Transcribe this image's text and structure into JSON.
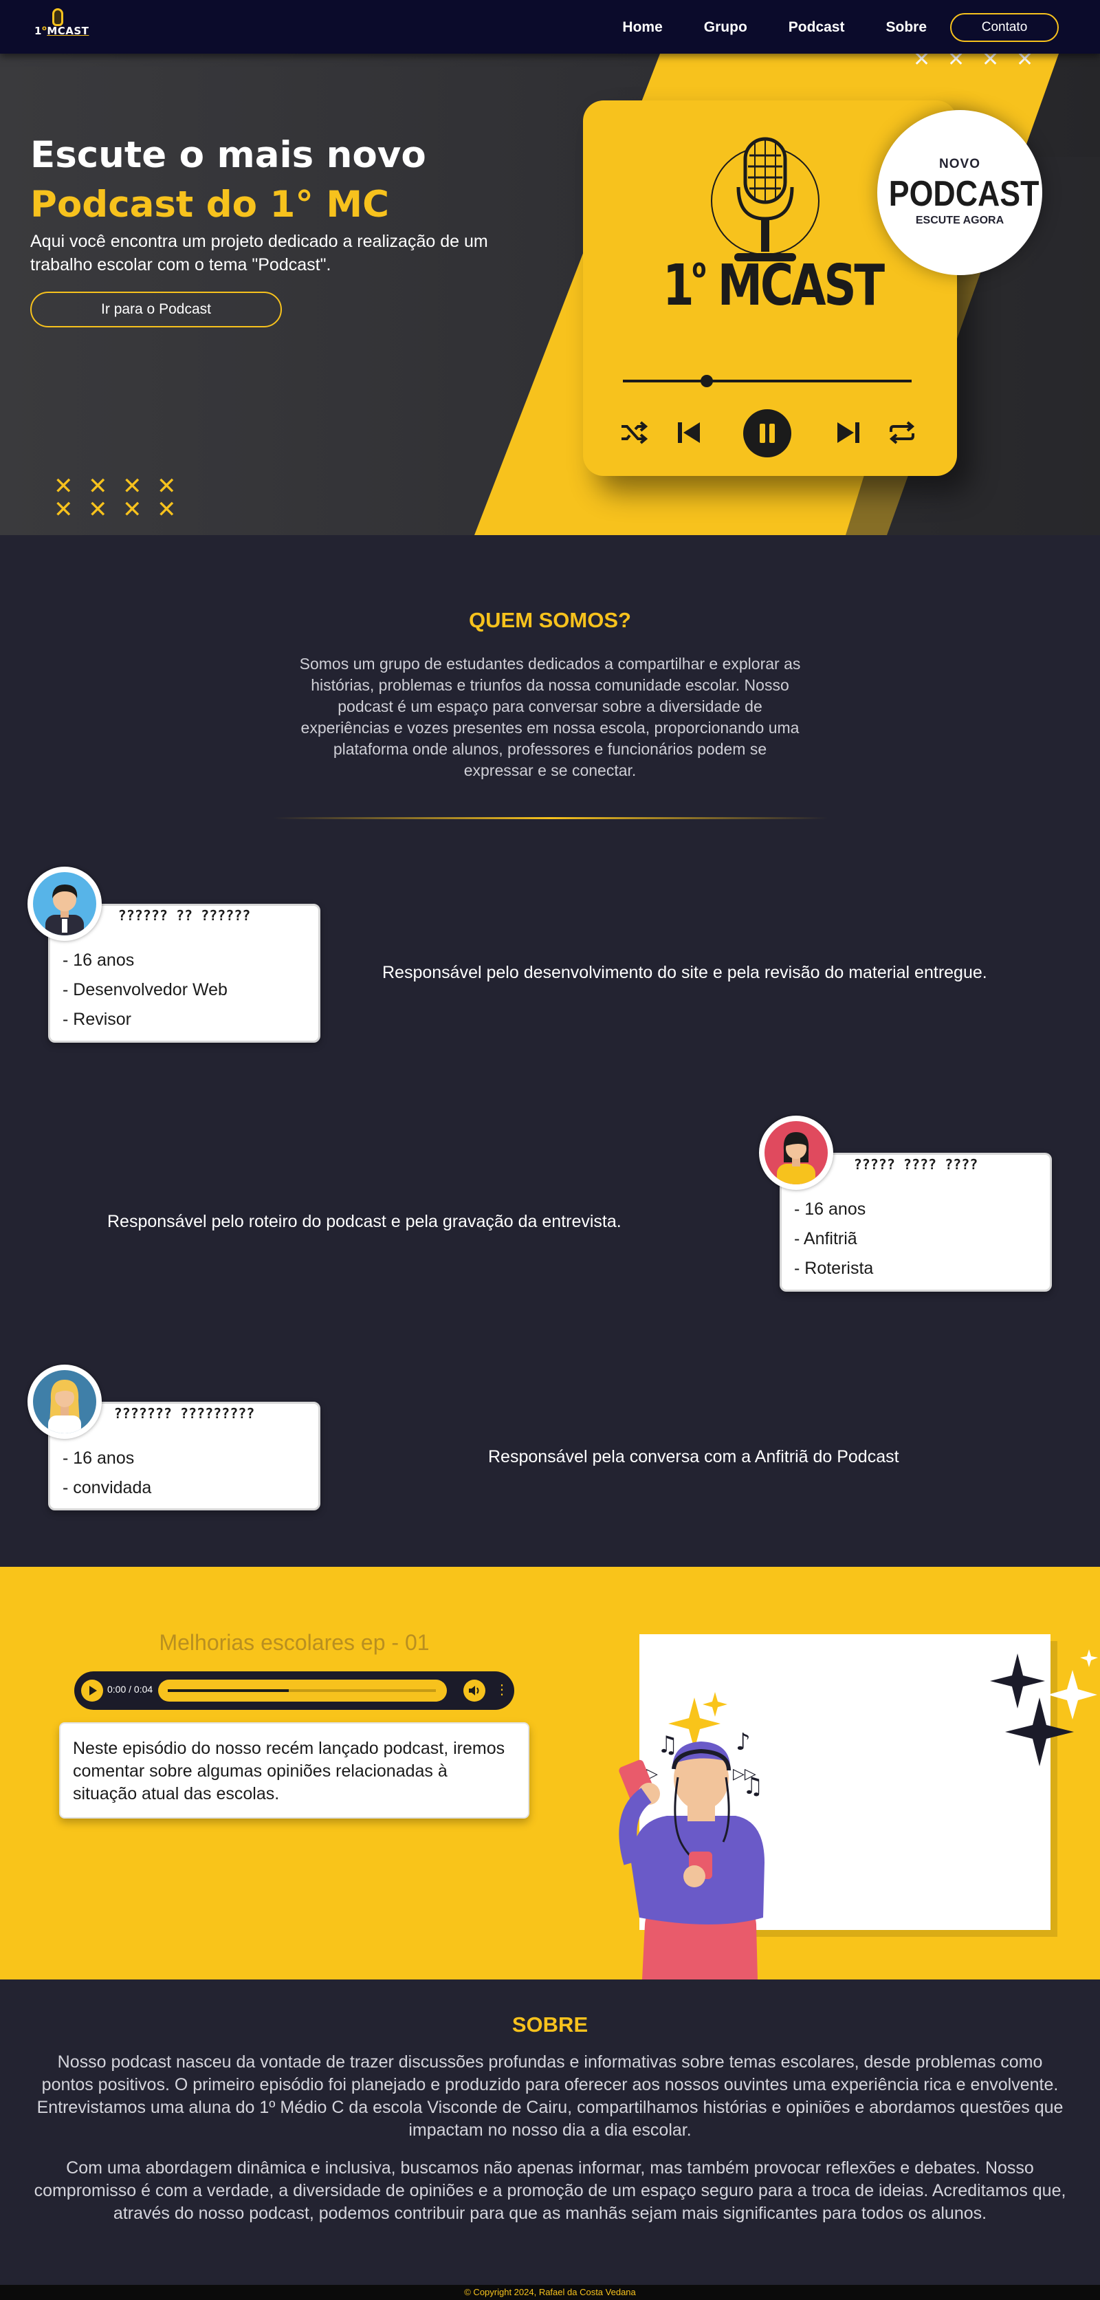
{
  "nav": {
    "logo_text": "1",
    "logo_sup": "o",
    "logo_word": "MCAST",
    "links": [
      "Home",
      "Grupo",
      "Podcast",
      "Sobre"
    ],
    "cta": "Contato"
  },
  "hero": {
    "title_line1": "Escute o mais novo",
    "title_line2": "Podcast do 1° MC",
    "description": "Aqui você encontra um projeto dedicado a realização de um trabalho escolar com o tema \"Podcast\".",
    "button": "Ir para o Podcast",
    "brand": "1",
    "brand_sup": "o",
    "brand_word": "MCAST",
    "badge_top": "NOVO",
    "badge_mid": "PODCAST",
    "badge_bottom": "ESCUTE AGORA",
    "player_progress": 0.29,
    "accent_color": "#f7c21d"
  },
  "about_group": {
    "title": "QUEM SOMOS?",
    "text": "Somos um grupo de estudantes dedicados a compartilhar e explorar as histórias, problemas e triunfos da nossa comunidade escolar. Nosso podcast é um espaço para conversar sobre a diversidade de experiências e vozes presentes em nossa escola, proporcionando uma plataforma onde alunos, professores e funcionários podem se expressar e se conectar."
  },
  "members": [
    {
      "name": "?????? ?? ??????",
      "lines": [
        "- 16 anos",
        "- Desenvolvedor Web",
        "- Revisor"
      ],
      "role": "Responsável pelo desenvolvimento do site e pela revisão do material entregue."
    },
    {
      "name": "????? ???? ????",
      "lines": [
        "- 16 anos",
        "- Anfitriã",
        "- Roterista"
      ],
      "role": "Responsável pelo roteiro do podcast e pela gravação da entrevista."
    },
    {
      "name": "??????? ?????????",
      "lines": [
        "- 16 anos",
        "- convidada"
      ],
      "role": "Responsável pela conversa com a Anfitriã do Podcast"
    }
  ],
  "episode": {
    "title": "Melhorias escolares ep - 01",
    "time": "0:00 / 0:04",
    "progress": 0.45,
    "description": "Neste episódio do nosso recém lançado podcast, iremos comentar sobre algumas opiniões relacionadas à situação atual das escolas."
  },
  "sobre": {
    "title": "SOBRE",
    "p1": "Nosso podcast nasceu da vontade de trazer discussões profundas e informativas sobre temas escolares, desde problemas como pontos positivos. O primeiro episódio foi planejado e produzido para oferecer aos nossos ouvintes uma experiência rica e envolvente. Entrevistamos uma aluna do 1º Médio C da escola Visconde de Cairu, compartilhamos histórias e opiniões e abordamos questões que impactam no nosso dia a dia escolar.",
    "p2": "Com uma abordagem dinâmica e inclusiva, buscamos não apenas informar, mas também provocar reflexões e debates. Nosso compromisso é com a verdade, a diversidade de opiniões e a promoção de um espaço seguro para a troca de ideias. Acreditamos que, através do nosso podcast, podemos contribuir para que as manhãs sejam mais significantes para todos os alunos."
  },
  "footer": {
    "text": "© Copyright 2024, Rafael da Costa Vedana"
  }
}
